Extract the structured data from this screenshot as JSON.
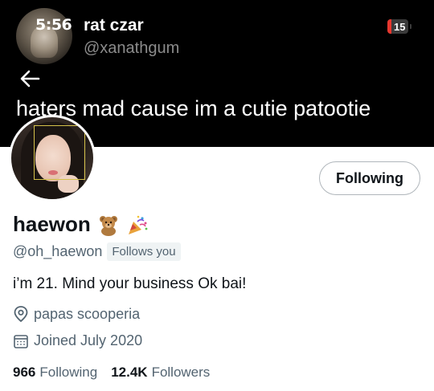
{
  "status_bar": {
    "time": "5:56",
    "battery_level": "15"
  },
  "tweet": {
    "author_name": "rat czar",
    "author_handle": "@xanathgum",
    "text": "haters mad cause im a cutie patootie"
  },
  "profile": {
    "display_name": "haewon",
    "name_emojis": [
      "teddy-bear-icon",
      "party-popper-icon"
    ],
    "handle": "@oh_haewon",
    "follows_you_label": "Follows you",
    "bio": "i’m 21. Mind your business Ok bai!",
    "location": "papas scooperia",
    "joined": "Joined July 2020",
    "following_count": "966",
    "following_label": "Following",
    "followers_count": "12.4K",
    "followers_label": "Followers",
    "follow_button_label": "Following"
  },
  "colors": {
    "header_bg": "#000000",
    "text_primary": "#0f1419",
    "text_secondary": "#536471",
    "battery_low": "#e8372e"
  }
}
